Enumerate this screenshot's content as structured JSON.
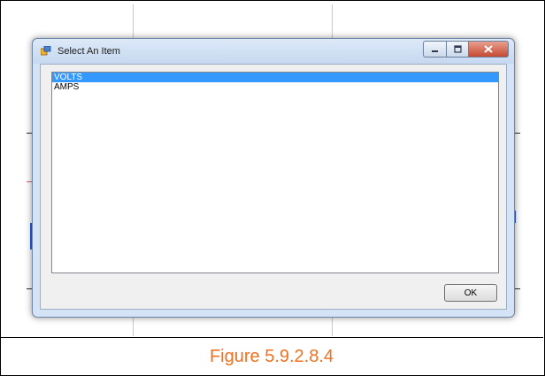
{
  "dialog": {
    "title": "Select An Item",
    "items": [
      {
        "label": "VOLTS",
        "selected": true
      },
      {
        "label": "AMPS",
        "selected": false
      }
    ],
    "ok_label": "OK",
    "icons": {
      "app": "app-window-icon",
      "minimize": "minimize-icon",
      "maximize": "maximize-icon",
      "close": "close-icon"
    }
  },
  "caption": "Figure 5.9.2.8.4",
  "colors": {
    "caption": "#f07020",
    "selection": "#3399ff"
  }
}
